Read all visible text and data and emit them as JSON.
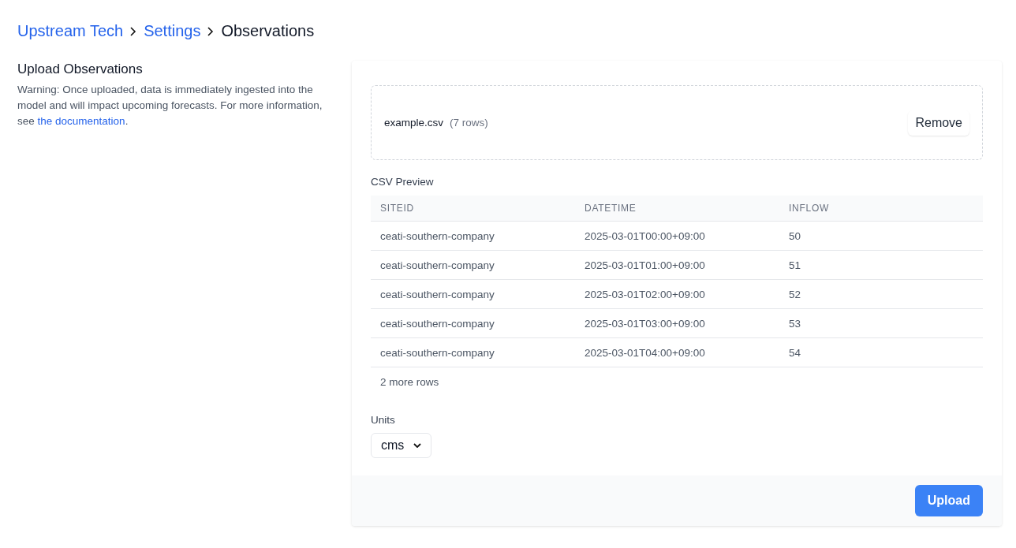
{
  "breadcrumb": [
    {
      "label": "Upstream Tech",
      "kind": "link"
    },
    {
      "label": "Settings",
      "kind": "link"
    },
    {
      "label": "Observations",
      "kind": "current"
    }
  ],
  "intro": {
    "title": "Upload Observations",
    "text": "Warning: Once uploaded, data is immediately ingested into the model and will impact upcoming forecasts. For more information, see ",
    "link": "the documentation",
    "end": "."
  },
  "file": {
    "name": "example.csv",
    "rows": "(7 rows)",
    "remove": "Remove"
  },
  "preview": {
    "title": "CSV Preview",
    "columns": [
      "SITEID",
      "DATETIME",
      "INFLOW"
    ],
    "rows": [
      [
        "ceati-southern-company",
        "2025-03-01T00:00+09:00",
        "50"
      ],
      [
        "ceati-southern-company",
        "2025-03-01T01:00+09:00",
        "51"
      ],
      [
        "ceati-southern-company",
        "2025-03-01T02:00+09:00",
        "52"
      ],
      [
        "ceati-southern-company",
        "2025-03-01T03:00+09:00",
        "53"
      ],
      [
        "ceati-southern-company",
        "2025-03-01T04:00+09:00",
        "54"
      ]
    ],
    "more": "2 more rows"
  },
  "units": {
    "label": "Units",
    "value": "cms"
  },
  "upload": "Upload"
}
